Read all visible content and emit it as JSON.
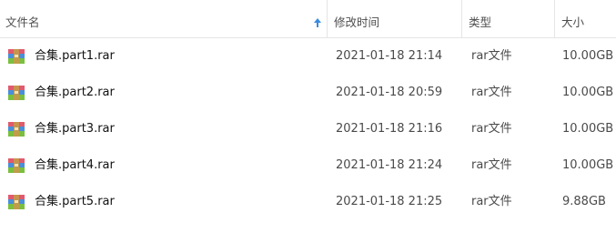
{
  "header": {
    "col_name": "文件名",
    "col_date": "修改时间",
    "col_type": "类型",
    "col_size": "大小",
    "sort_icon": "sort-ascending-arrow-icon",
    "sort_color": "#3a8be0"
  },
  "file_icon": "winrar-archive-icon",
  "rows": [
    {
      "name": "合集.part1.rar",
      "date": "2021-01-18 21:14",
      "type": "rar文件",
      "size": "10.00GB"
    },
    {
      "name": "合集.part2.rar",
      "date": "2021-01-18 20:59",
      "type": "rar文件",
      "size": "10.00GB"
    },
    {
      "name": "合集.part3.rar",
      "date": "2021-01-18 21:16",
      "type": "rar文件",
      "size": "10.00GB"
    },
    {
      "name": "合集.part4.rar",
      "date": "2021-01-18 21:24",
      "type": "rar文件",
      "size": "10.00GB"
    },
    {
      "name": "合集.part5.rar",
      "date": "2021-01-18 21:25",
      "type": "rar文件",
      "size": "9.88GB"
    }
  ]
}
